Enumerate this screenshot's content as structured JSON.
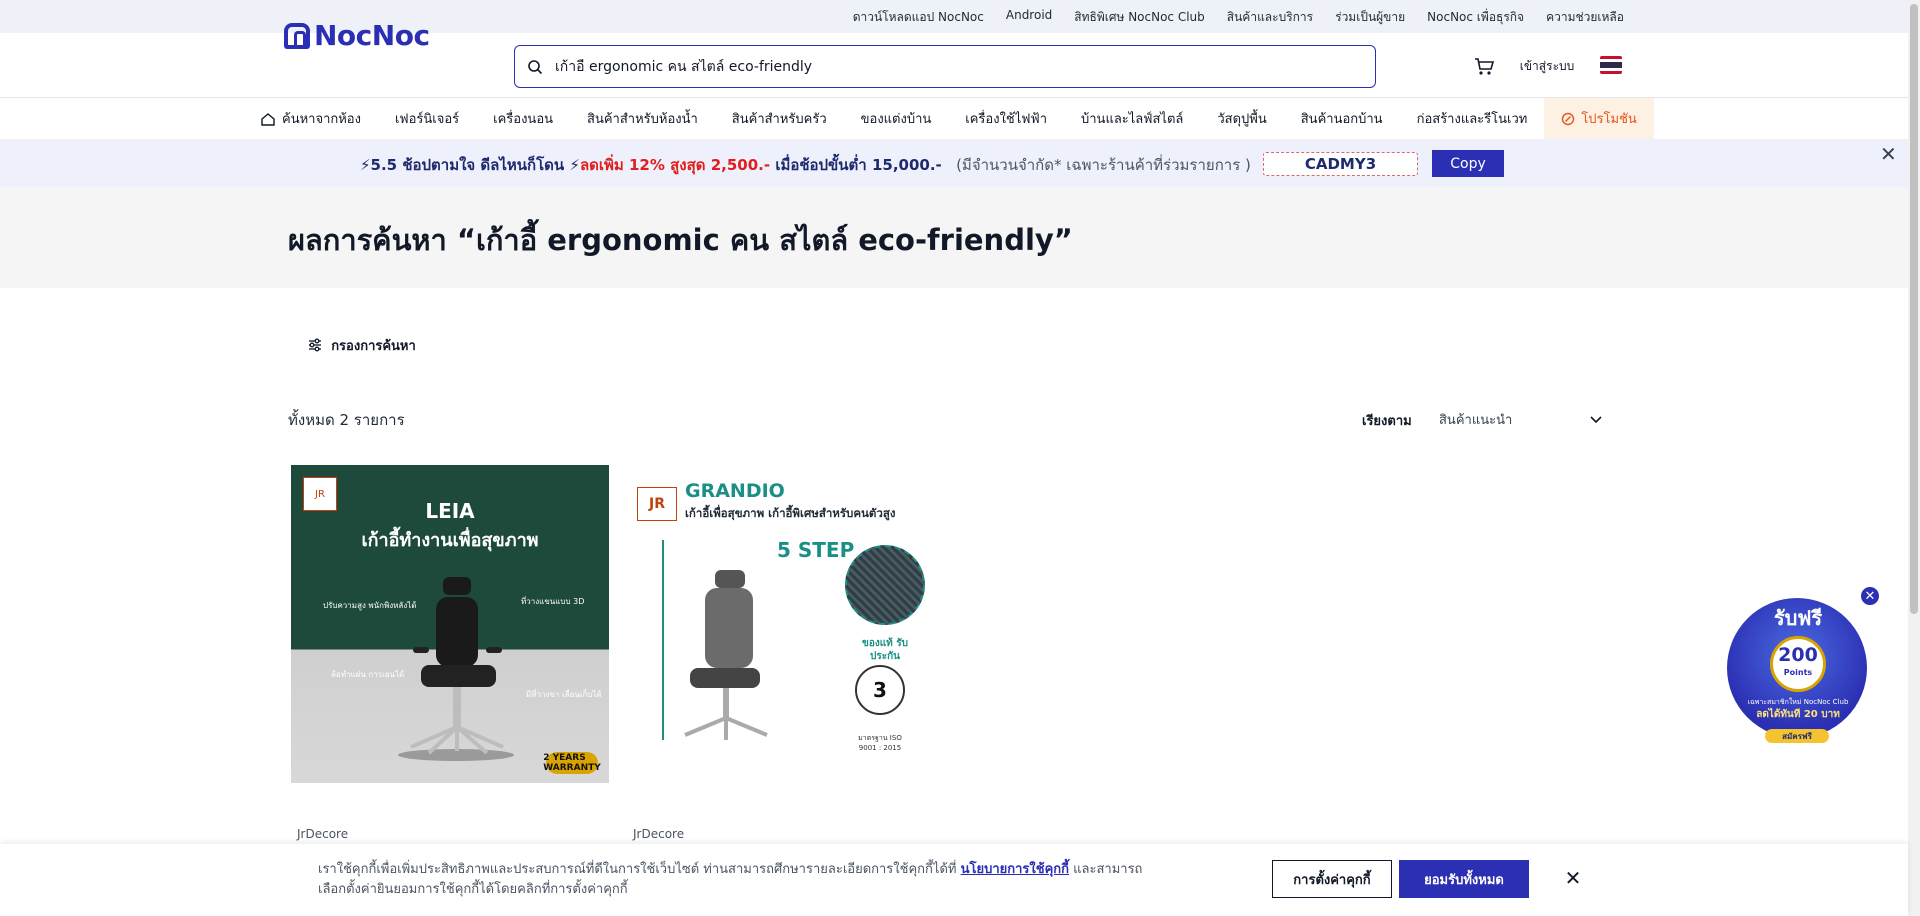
{
  "topbar": {
    "links": [
      "ดาวน์โหลดแอป NocNoc",
      "Android",
      "สิทธิพิเศษ NocNoc Club",
      "สินค้าและบริการ",
      "ร่วมเป็นผู้ขาย",
      "NocNoc เพื่อธุรกิจ",
      "ความช่วยเหลือ"
    ]
  },
  "header": {
    "logo": "NocNoc",
    "search_value": "เก้าอี้ ergonomic คน สไตล์ eco-friendly",
    "login": "เข้าสู่ระบบ"
  },
  "categories": [
    "ค้นหาจากห้อง",
    "เฟอร์นิเจอร์",
    "เครื่องนอน",
    "สินค้าสำหรับห้องน้ำ",
    "สินค้าสำหรับครัว",
    "ของแต่งบ้าน",
    "เครื่องใช้ไฟฟ้า",
    "บ้านและไลฟ์สไตล์",
    "วัสดุปูพื้น",
    "สินค้านอกบ้าน",
    "ก่อสร้างและรีโนเวท",
    "โปรโมชัน"
  ],
  "promo": {
    "part1": "⚡5.5 ช้อปตามใจ ดีลไหนก็โดน ⚡",
    "part2": "ลดเพิ่ม 12% สูงสุด 2,500.-",
    "part3": " เมื่อช้อปขั้นต่ำ 15,000.-",
    "part4": "(มีจำนวนจำกัด* เฉพาะร้านค้าที่ร่วมรายการ )",
    "code": "CADMY3",
    "copy": "Copy"
  },
  "search": {
    "title": "ผลการค้นหา “เก้าอี้ ergonomic คน สไตล์ eco-friendly”",
    "filter": "กรองการค้นหา",
    "count": "ทั้งหมด 2 รายการ",
    "sort_label": "เรียงตาม",
    "sort_value": "สินค้าแนะนำ"
  },
  "products": [
    {
      "brand": "JrDecore",
      "image_title": "LEIA",
      "image_subtitle": "เก้าอี้ทำงานเพื่อสุขภาพ",
      "notes": [
        "ปรับความสูง พนักพิงหลังได้",
        "ที่วางแขนแบบ 3D",
        "ล้อทำแผ่น การเอนได้",
        "มีที่วางขา เลื่อนเก็บได้"
      ],
      "badge": "2 YEARS WARRANTY"
    },
    {
      "brand": "JrDecore",
      "image_logo": "JR",
      "image_title": "GRANDIO",
      "image_subtitle": "เก้าอี้เพื่อสุขภาพ เก้าอี้พิเศษสำหรับคนตัวสูง",
      "step": "5 STEP",
      "genuine": "ของแท้ รับประกัน",
      "warranty": "3",
      "iso": "มาตรฐาน ISO 9001 : 2015"
    }
  ],
  "floating_promo": {
    "title": "รับฟรี",
    "points": "200",
    "points_label": "Points",
    "line1": "เฉพาะสมาชิกใหม่ NocNoc Club",
    "line2": "ลดได้ทันที 20 บาท",
    "signup": "สมัครฟรี"
  },
  "cookie": {
    "text1": "เราใช้คุกกี้เพื่อเพิ่มประสิทธิภาพและประสบการณ์ที่ดีในการใช้เว็บไซต์ ท่านสามารถศึกษารายละเอียดการใช้คุกกี้ได้ที่ ",
    "link": "นโยบายการใช้คุกกี้",
    "text2": " และสามารถเลือกตั้งค่ายินยอมการใช้คุกกี้ได้โดยคลิกที่การตั้งค่าคุกกี้",
    "settings": "การตั้งค่าคุกกี้",
    "accept": "ยอมรับทั้งหมด"
  },
  "colors": {
    "brand": "#2b2fb3",
    "promo_red": "#e11d1d",
    "promo_tab": "#e8541b"
  }
}
